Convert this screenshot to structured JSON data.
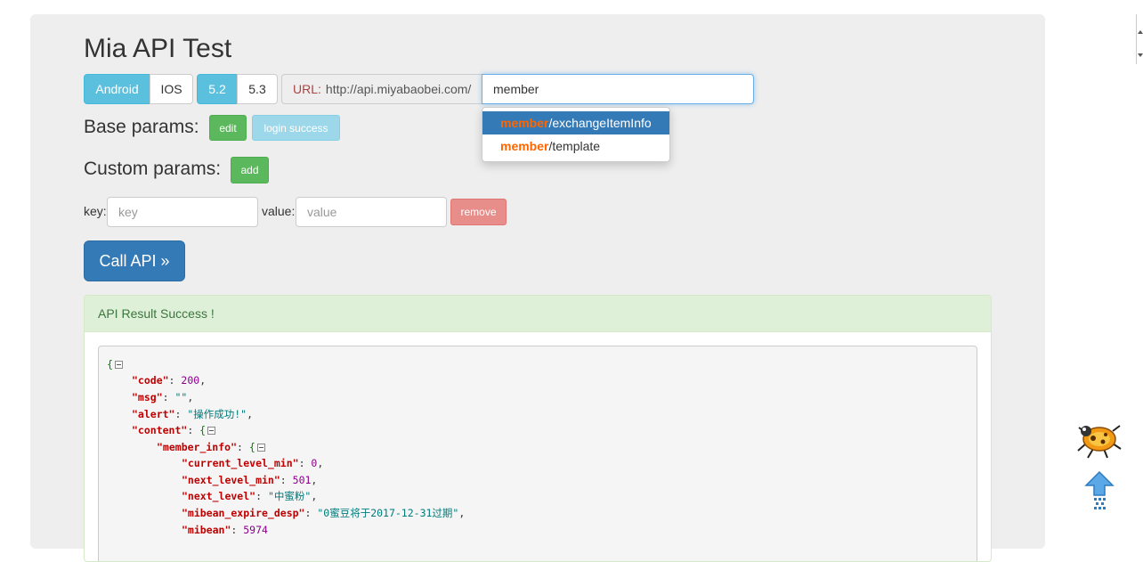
{
  "page": {
    "title": "Mia API Test"
  },
  "platform": {
    "android": "Android",
    "ios": "IOS"
  },
  "version": {
    "v1": "5.2",
    "v2": "5.3"
  },
  "url": {
    "label": "URL:",
    "base": "http://api.miyabaobei.com/",
    "value": "member"
  },
  "autocomplete": [
    {
      "match": "member",
      "rest": "/exchangeItemInfo"
    },
    {
      "match": "member",
      "rest": "/template"
    }
  ],
  "base_params": {
    "label": "Base params:",
    "edit": "edit",
    "login": "login success"
  },
  "custom_params": {
    "label": "Custom params:",
    "add": "add"
  },
  "param_row": {
    "key_label": "key:",
    "key_placeholder": "key",
    "value_label": "value:",
    "value_placeholder": "value",
    "remove": "remove"
  },
  "call_button": "Call API »",
  "result": {
    "heading": "API Result Success !",
    "json": {
      "open": "{",
      "code_key": "\"code\"",
      "code_val": "200",
      "msg_key": "\"msg\"",
      "msg_val": "\"\"",
      "alert_key": "\"alert\"",
      "alert_val": "\"操作成功!\"",
      "content_key": "\"content\"",
      "content_open": "{",
      "member_info_key": "\"member_info\"",
      "member_info_open": "{",
      "current_level_min_key": "\"current_level_min\"",
      "current_level_min_val": "0",
      "next_level_min_key": "\"next_level_min\"",
      "next_level_min_val": "501",
      "next_level_key": "\"next_level\"",
      "next_level_val": "\"中蜜粉\"",
      "mibean_expire_desp_key": "\"mibean_expire_desp\"",
      "mibean_expire_desp_val": "\"0蜜豆将于2017-12-31过期\"",
      "mibean_key": "\"mibean\"",
      "mibean_val": "5974"
    }
  },
  "colors": {
    "primary": "#337ab7",
    "info": "#5bc0de",
    "success": "#5cb85c",
    "danger": "#d9534f",
    "highlight": "#ff6600"
  }
}
